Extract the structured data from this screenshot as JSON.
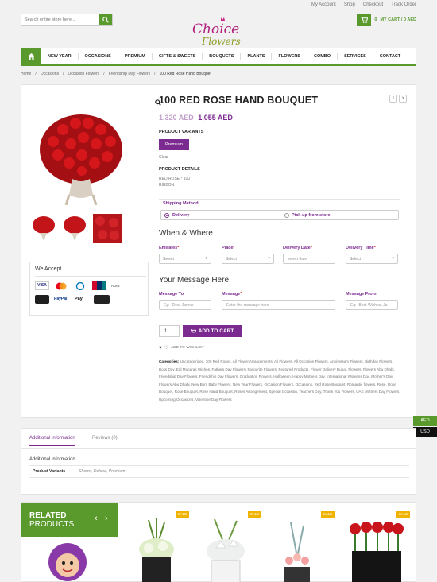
{
  "topbar": {
    "links": [
      "My Account",
      "Shop",
      "Checkout",
      "Track Order"
    ]
  },
  "search": {
    "placeholder": "Search entire store here..."
  },
  "logo": {
    "line1": "Choice",
    "line2": "Flowers"
  },
  "cart": {
    "count": "0",
    "label": "MY CART / 0 AED"
  },
  "nav": {
    "items": [
      "NEW YEAR",
      "OCCASIONS",
      "PREMIUM",
      "GIFTS & SWEETS",
      "BOUQUETS",
      "PLANTS",
      "FLOWERS",
      "COMBO",
      "SERVICES",
      "CONTACT"
    ]
  },
  "breadcrumb": [
    "Home",
    "/",
    "Occasions",
    "/",
    "Occasion Flowers",
    "/",
    "Friendship Day Flowers",
    "/",
    "100 Red Rose Hand Bouquet"
  ],
  "product": {
    "title": "100 RED ROSE HAND BOUQUET",
    "old_price": "1,320 AED",
    "price": "1,055 AED",
    "variants_label": "PRODUCT VARIANTS",
    "variant": "Premium",
    "clear": "Clear",
    "details_label": "PRODUCT DETAILS",
    "details_line1": "RED ROSE * 100",
    "details_line2": "RIBBON"
  },
  "shipping": {
    "label": "Shipping Method",
    "opt1": "Delivery",
    "opt2": "Pick-up from store"
  },
  "when": {
    "title": "When & Where",
    "emirates": "Emirates",
    "place": "Place",
    "date": "Delivery Date",
    "time": "Delivery Time",
    "select": "Select",
    "date_ph": "select date"
  },
  "message": {
    "title": "Your Message Here",
    "to": "Message To",
    "msg": "Message",
    "from": "Message From",
    "to_ph": "Eg:- Dear James",
    "msg_ph": "Enter the message here",
    "from_ph": "Eg:- Best Wishes, Ja"
  },
  "cart_form": {
    "qty": "1",
    "add": "ADD TO CART",
    "wishlist": "ADD TO WISHLIST"
  },
  "categories": {
    "label": "Categories:",
    "text": "Uncategorized, 100 Red Roses, All Flower Arrangements, All Flowers, All Occasion Flowers, Anniversary Flowers, Birthday Flowers, Boss Day, Eid Mubarak Wishes, Fathers Day Flowers, Favourite Flowers, Featured Products, Flower Delivery Dubai, Flowers, Flowers Abu Dhabi, Friendship Day Flowers, Friendship Day Flowers, Graduation Flowers, Halloween, Happy Mothers Day, International Womens Day, Mother's Day Flowers Abu Dhabi, New Born Baby Flowers, New Year Flowers, Occasion Flowers, Occasions, Red Rose Bouquet, Romantic flowers, Rose, Rose Bouquet, Rose Bouquet, Rose Hand Bouquet, Roses Arrangement, Special Occasion, Teachers Day, Thank You Flowers, UAE Mothers Day Flowers, Upcoming Occasions, Valentine Day Flowers"
  },
  "accept": {
    "title": "We Accept",
    "cards": [
      "VISA",
      "MC",
      "DC",
      "UPay",
      "ADIB",
      "AMEX",
      "PayPal",
      "Pay",
      "G Pay"
    ]
  },
  "currency": {
    "aed": "AED",
    "usd": "USD"
  },
  "tabs": {
    "tab1": "Additional information",
    "tab2": "Reviews (0)",
    "heading": "Additional information",
    "row_label": "Product Variants",
    "row_value": "Shown, Deluxe, Premium"
  },
  "related": {
    "line1": "RELATED",
    "line2": "PRODUCTS",
    "badge": "SALE"
  }
}
